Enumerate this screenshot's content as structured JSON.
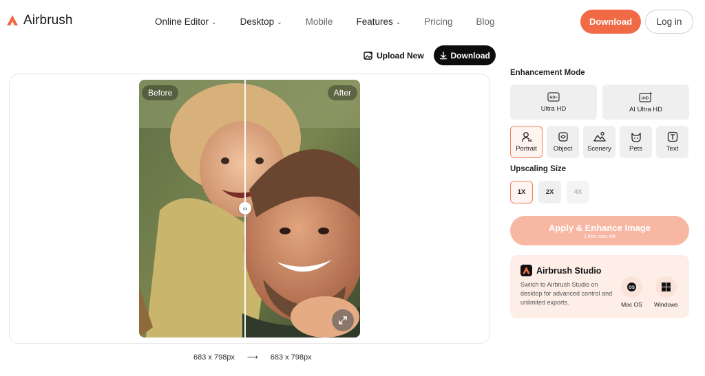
{
  "brand": {
    "name": "Airbrush",
    "accent": "#f06a45"
  },
  "nav": {
    "items": [
      {
        "label": "Online Editor",
        "dropdown": true
      },
      {
        "label": "Desktop",
        "dropdown": true
      },
      {
        "label": "Mobile",
        "dropdown": false
      },
      {
        "label": "Features",
        "dropdown": true
      },
      {
        "label": "Pricing",
        "dropdown": false
      },
      {
        "label": "Blog",
        "dropdown": false
      }
    ],
    "download_label": "Download",
    "login_label": "Log in"
  },
  "toolbar": {
    "upload_label": "Upload New",
    "download_label": "Download"
  },
  "preview": {
    "before_label": "Before",
    "after_label": "After",
    "input_size": "683 x 798px",
    "arrow": "⟶",
    "output_size": "683 x 798px"
  },
  "panel": {
    "mode_title": "Enhancement Mode",
    "modes": [
      {
        "label": "Ultra HD",
        "icon": "hd-plus-icon",
        "badge": "HD+"
      },
      {
        "label": "AI Ultra HD",
        "icon": "uhd-sparkle-icon",
        "badge": "UHD"
      }
    ],
    "subjects": [
      {
        "label": "Portrait",
        "icon": "portrait-icon",
        "selected": true
      },
      {
        "label": "Object",
        "icon": "object-icon",
        "selected": false
      },
      {
        "label": "Scenery",
        "icon": "scenery-icon",
        "selected": false
      },
      {
        "label": "Pets",
        "icon": "pets-icon",
        "selected": false
      },
      {
        "label": "Text",
        "icon": "text-icon",
        "selected": false
      }
    ],
    "size_title": "Upscaling Size",
    "sizes": [
      {
        "label": "1X",
        "state": "selected"
      },
      {
        "label": "2X",
        "state": "normal"
      },
      {
        "label": "4X",
        "state": "disabled"
      }
    ],
    "apply_label": "Apply & Enhance Image",
    "apply_sub": "2 free uses left",
    "studio": {
      "title": "Airbrush Studio",
      "desc": "Switch to Airbrush Studio on desktop for advanced control and unlimited exports.",
      "mac_label": "Mac OS",
      "win_label": "Windows"
    }
  }
}
